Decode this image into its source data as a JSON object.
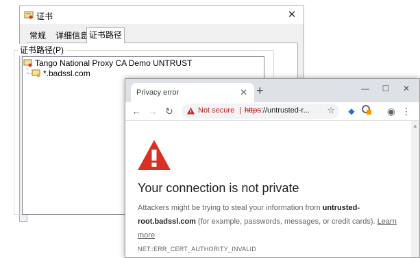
{
  "cert_dialog": {
    "title": "证书",
    "tabs": [
      {
        "label": "常规",
        "active": false
      },
      {
        "label": "详细信息",
        "active": false
      },
      {
        "label": "证书路径",
        "active": true
      }
    ],
    "group_label": "证书路径(P)",
    "tree": [
      {
        "label": "Tango National Proxy CA Demo UNTRUST",
        "level": 0
      },
      {
        "label": "*.badssl.com",
        "level": 1
      }
    ]
  },
  "browser": {
    "tab_title": "Privacy error",
    "security_label": "Not secure",
    "url_separator": "|",
    "url_scheme": "https",
    "url_rest": "://untrusted-r...",
    "heading": "Your connection is not private",
    "description_prefix": "Attackers might be trying to steal your information from ",
    "description_host": "untrusted-root.badssl.com",
    "description_suffix": " (for example, passwords, messages, or credit cards). ",
    "learn_more": "Learn more",
    "error_code": "NET::ERR_CERT_AUTHORITY_INVALID"
  },
  "colors": {
    "warning_red": "#d93025",
    "not_secure_red": "#c5221f",
    "tabstrip_gray": "#dee1e6"
  }
}
